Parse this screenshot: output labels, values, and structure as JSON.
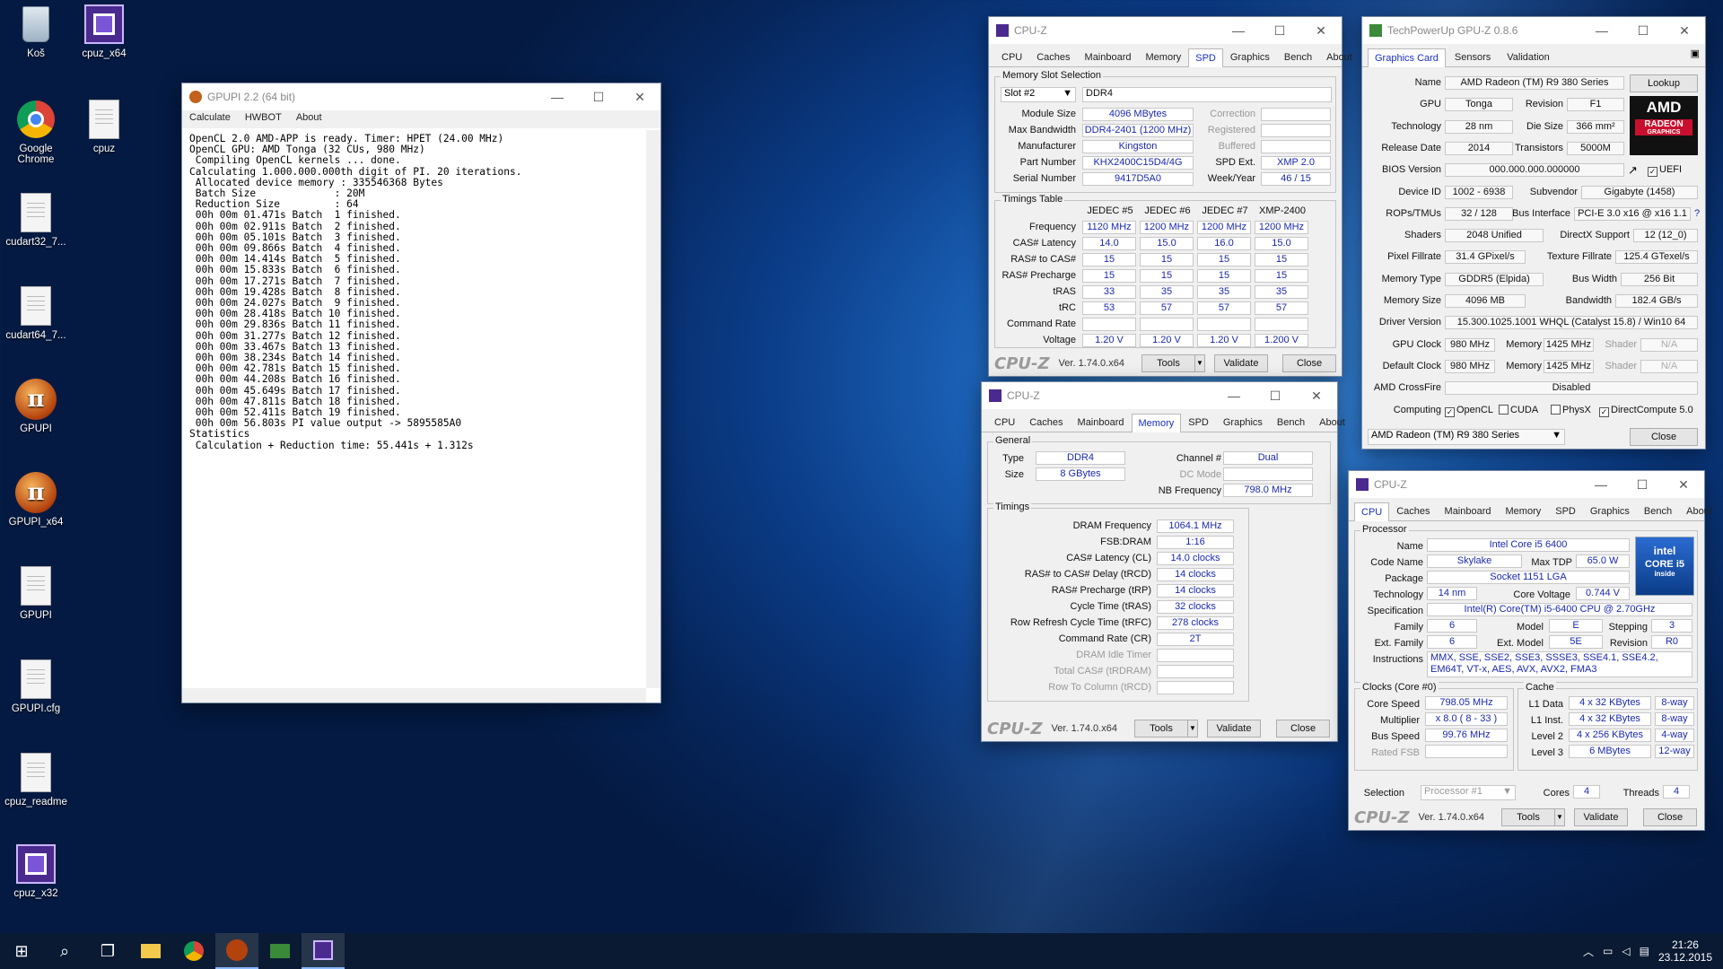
{
  "desktop": {
    "icons": [
      {
        "label": "Koš"
      },
      {
        "label": "cpuz_x64"
      },
      {
        "label": "Google Chrome"
      },
      {
        "label": "cpuz"
      },
      {
        "label": "cudart32_7..."
      },
      {
        "label": "cudart64_7..."
      },
      {
        "label": "GPUPI"
      },
      {
        "label": "GPUPI_x64"
      },
      {
        "label": "GPUPI"
      },
      {
        "label": "GPUPI.cfg"
      },
      {
        "label": "cpuz_readme"
      },
      {
        "label": "cpuz_x32"
      }
    ]
  },
  "gpupi": {
    "title": "GPUPI 2.2 (64 bit)",
    "menu": [
      "Calculate",
      "HWBOT",
      "About"
    ],
    "lines": [
      "OpenCL 2.0 AMD-APP is ready. Timer: HPET (24.00 MHz)",
      "",
      "OpenCL GPU: AMD Tonga (32 CUs, 980 MHz)",
      " Compiling OpenCL kernels ... done.",
      "",
      "Calculating 1.000.000.000th digit of PI. 20 iterations.",
      "",
      " Allocated device memory : 335546368 Bytes",
      " Batch Size             : 20M",
      " Reduction Size         : 64",
      "",
      " 00h 00m 01.471s Batch  1 finished.",
      " 00h 00m 02.911s Batch  2 finished.",
      " 00h 00m 05.101s Batch  3 finished.",
      " 00h 00m 09.866s Batch  4 finished.",
      " 00h 00m 14.414s Batch  5 finished.",
      " 00h 00m 15.833s Batch  6 finished.",
      " 00h 00m 17.271s Batch  7 finished.",
      " 00h 00m 19.428s Batch  8 finished.",
      " 00h 00m 24.027s Batch  9 finished.",
      " 00h 00m 28.418s Batch 10 finished.",
      " 00h 00m 29.836s Batch 11 finished.",
      " 00h 00m 31.277s Batch 12 finished.",
      " 00h 00m 33.467s Batch 13 finished.",
      " 00h 00m 38.234s Batch 14 finished.",
      " 00h 00m 42.781s Batch 15 finished.",
      " 00h 00m 44.208s Batch 16 finished.",
      " 00h 00m 45.649s Batch 17 finished.",
      " 00h 00m 47.811s Batch 18 finished.",
      " 00h 00m 52.411s Batch 19 finished.",
      " 00h 00m 56.803s PI value output -> 5895585A0",
      "",
      "Statistics",
      "",
      " Calculation + Reduction time: 55.441s + 1.312s"
    ]
  },
  "cpuz_tabs": [
    "CPU",
    "Caches",
    "Mainboard",
    "Memory",
    "SPD",
    "Graphics",
    "Bench",
    "About"
  ],
  "cpuz_common": {
    "title": "CPU-Z",
    "brand": "CPU-Z",
    "version": "Ver. 1.74.0.x64",
    "tools": "Tools",
    "validate": "Validate",
    "close": "Close"
  },
  "spd": {
    "group": "Memory Slot Selection",
    "slot": "Slot #2",
    "type": "DDR4",
    "rows": [
      [
        "Module Size",
        "4096 MBytes",
        "Correction",
        ""
      ],
      [
        "Max Bandwidth",
        "DDR4-2401 (1200 MHz)",
        "Registered",
        ""
      ],
      [
        "Manufacturer",
        "Kingston",
        "Buffered",
        ""
      ],
      [
        "Part Number",
        "KHX2400C15D4/4G",
        "SPD Ext.",
        "XMP 2.0"
      ],
      [
        "Serial Number",
        "9417D5A0",
        "Week/Year",
        "46 / 15"
      ]
    ],
    "timings_group": "Timings Table",
    "cols": [
      "JEDEC #5",
      "JEDEC #6",
      "JEDEC #7",
      "XMP-2400"
    ],
    "trows": [
      [
        "Frequency",
        "1120 MHz",
        "1200 MHz",
        "1200 MHz",
        "1200 MHz"
      ],
      [
        "CAS# Latency",
        "14.0",
        "15.0",
        "16.0",
        "15.0"
      ],
      [
        "RAS# to CAS#",
        "15",
        "15",
        "15",
        "15"
      ],
      [
        "RAS# Precharge",
        "15",
        "15",
        "15",
        "15"
      ],
      [
        "tRAS",
        "33",
        "35",
        "35",
        "35"
      ],
      [
        "tRC",
        "53",
        "57",
        "57",
        "57"
      ],
      [
        "Command Rate",
        "",
        "",
        "",
        ""
      ],
      [
        "Voltage",
        "1.20 V",
        "1.20 V",
        "1.20 V",
        "1.200 V"
      ]
    ]
  },
  "mem": {
    "general": "General",
    "type_l": "Type",
    "type": "DDR4",
    "size_l": "Size",
    "size": "8 GBytes",
    "ch_l": "Channel #",
    "ch": "Dual",
    "dc_l": "DC Mode",
    "nb_l": "NB Frequency",
    "nb": "798.0 MHz",
    "timings": "Timings",
    "rows": [
      [
        "DRAM Frequency",
        "1064.1 MHz"
      ],
      [
        "FSB:DRAM",
        "1:16"
      ],
      [
        "CAS# Latency (CL)",
        "14.0 clocks"
      ],
      [
        "RAS# to CAS# Delay (tRCD)",
        "14 clocks"
      ],
      [
        "RAS# Precharge (tRP)",
        "14 clocks"
      ],
      [
        "Cycle Time (tRAS)",
        "32 clocks"
      ],
      [
        "Row Refresh Cycle Time (tRFC)",
        "278 clocks"
      ],
      [
        "Command Rate (CR)",
        "2T"
      ],
      [
        "DRAM Idle Timer",
        ""
      ],
      [
        "Total CAS# (tRDRAM)",
        ""
      ],
      [
        "Row To Column (tRCD)",
        ""
      ]
    ]
  },
  "cpu": {
    "processor": "Processor",
    "name_l": "Name",
    "name": "Intel Core i5 6400",
    "code_l": "Code Name",
    "code": "Skylake",
    "tdp_l": "Max TDP",
    "tdp": "65.0 W",
    "pkg_l": "Package",
    "pkg": "Socket 1151 LGA",
    "tech_l": "Technology",
    "tech": "14 nm",
    "cv_l": "Core Voltage",
    "cv": "0.744 V",
    "spec_l": "Specification",
    "spec": "Intel(R) Core(TM) i5-6400 CPU @ 2.70GHz",
    "fam_l": "Family",
    "fam": "6",
    "model_l": "Model",
    "model": "E",
    "step_l": "Stepping",
    "step": "3",
    "efam_l": "Ext. Family",
    "efam": "6",
    "emodel_l": "Ext. Model",
    "emodel": "5E",
    "rev_l": "Revision",
    "rev": "R0",
    "instr_l": "Instructions",
    "instr": "MMX, SSE, SSE2, SSE3, SSSE3, SSE4.1, SSE4.2, EM64T, VT-x, AES, AVX, AVX2, FMA3",
    "clocks": "Clocks (Core #0)",
    "cs_l": "Core Speed",
    "cs": "798.05 MHz",
    "mul_l": "Multiplier",
    "mul": "x 8.0 ( 8 - 33 )",
    "bus_l": "Bus Speed",
    "bus": "99.76 MHz",
    "fsb_l": "Rated FSB",
    "cache": "Cache",
    "l1d_l": "L1 Data",
    "l1d": "4 x 32 KBytes",
    "l1d_w": "8-way",
    "l1i_l": "L1 Inst.",
    "l1i": "4 x 32 KBytes",
    "l1i_w": "8-way",
    "l2_l": "Level 2",
    "l2": "4 x 256 KBytes",
    "l2_w": "4-way",
    "l3_l": "Level 3",
    "l3": "6 MBytes",
    "l3_w": "12-way",
    "sel_l": "Selection",
    "sel": "Processor #1",
    "cores_l": "Cores",
    "cores": "4",
    "threads_l": "Threads",
    "threads": "4",
    "logo1": "intel",
    "logo2": "CORE i5",
    "logo3": "inside"
  },
  "gpuz": {
    "title": "TechPowerUp GPU-Z 0.8.6",
    "tabs": [
      "Graphics Card",
      "Sensors",
      "Validation"
    ],
    "name_l": "Name",
    "name": "AMD Radeon (TM) R9 380 Series",
    "lookup": "Lookup",
    "gpu_l": "GPU",
    "gpu": "Tonga",
    "rev_l": "Revision",
    "rev": "F1",
    "tech_l": "Technology",
    "tech": "28 nm",
    "die_l": "Die Size",
    "die": "366 mm²",
    "rel_l": "Release Date",
    "rel": "2014",
    "tr_l": "Transistors",
    "tr": "5000M",
    "bios_l": "BIOS Version",
    "bios": "000.000.000.000000",
    "uefi": "UEFI",
    "dev_l": "Device ID",
    "dev": "1002 - 6938",
    "sub_l": "Subvendor",
    "sub": "Gigabyte (1458)",
    "rops_l": "ROPs/TMUs",
    "rops": "32 / 128",
    "bi_l": "Bus Interface",
    "bi": "PCI-E 3.0 x16 @ x16 1.1",
    "q": "?",
    "sh_l": "Shaders",
    "sh": "2048 Unified",
    "dx_l": "DirectX Support",
    "dx": "12 (12_0)",
    "pf_l": "Pixel Fillrate",
    "pf": "31.4 GPixel/s",
    "tf_l": "Texture Fillrate",
    "tf": "125.4 GTexel/s",
    "mt_l": "Memory Type",
    "mt": "GDDR5 (Elpida)",
    "bw_l": "Bus Width",
    "bw": "256 Bit",
    "ms_l": "Memory Size",
    "ms": "4096 MB",
    "band_l": "Bandwidth",
    "band": "182.4 GB/s",
    "drv_l": "Driver Version",
    "drv": "15.300.1025.1001 WHQL (Catalyst 15.8) / Win10 64",
    "gc_l": "GPU Clock",
    "gc": "980 MHz",
    "mem_l": "Memory",
    "gm": "1425 MHz",
    "shd_l": "Shader",
    "na": "N/A",
    "dc_l": "Default Clock",
    "dc": "980 MHz",
    "dm": "1425 MHz",
    "cf_l": "AMD CrossFire",
    "cf": "Disabled",
    "comp_l": "Computing",
    "opencl": "OpenCL",
    "cuda": "CUDA",
    "physx": "PhysX",
    "dcomp": "DirectCompute 5.0",
    "sel": "AMD Radeon (TM) R9 380 Series",
    "close": "Close",
    "logo1": "AMD",
    "logo2": "RADEON",
    "logo3": "GRAPHICS"
  },
  "taskbar": {
    "time": "21:26",
    "date": "23.12.2015"
  },
  "colors": {
    "value_blue": "#1a28b0",
    "desktop": "#0b3c87"
  }
}
